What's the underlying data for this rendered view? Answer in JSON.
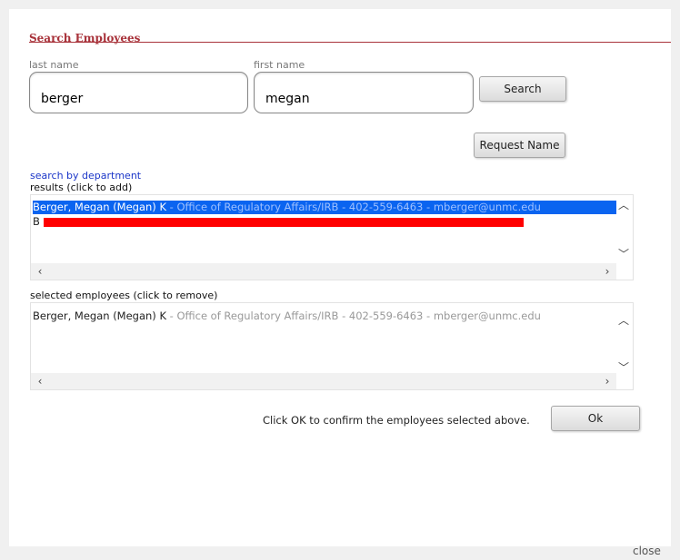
{
  "dialog": {
    "title": "Search Employees",
    "close_label": "close"
  },
  "search": {
    "last_name_label": "last name",
    "last_name_value": "berger",
    "first_name_label": "first name",
    "first_name_value": "megan",
    "search_button": "Search",
    "request_name_button": "Request Name",
    "department_link": "search by department"
  },
  "results": {
    "label": "results (click to add)",
    "items": [
      {
        "name": "Berger, Megan (Megan) K",
        "detail": " - Office of Regulatory Affairs/IRB - 402-559-6463 - mberger@unmc.edu",
        "selected": true
      },
      {
        "name": "B",
        "detail": "",
        "selected": false,
        "redacted": true
      }
    ]
  },
  "selected": {
    "label": "selected employees (click to remove)",
    "items": [
      {
        "name": "Berger, Megan (Megan) K",
        "detail": " - Office of Regulatory Affairs/IRB - 402-559-6463 - mberger@unmc.edu"
      }
    ]
  },
  "footer": {
    "confirm_text": "Click OK to confirm the employees selected above.",
    "ok_button": "Ok"
  },
  "colors": {
    "title": "#a8323a",
    "selection": "#0a64f0",
    "link": "#1a35c8",
    "redaction": "#ff0000"
  },
  "icons": {
    "scroll_up": "chevron-up-icon",
    "scroll_down": "chevron-down-icon",
    "scroll_left": "chevron-left-icon",
    "scroll_right": "chevron-right-icon"
  }
}
